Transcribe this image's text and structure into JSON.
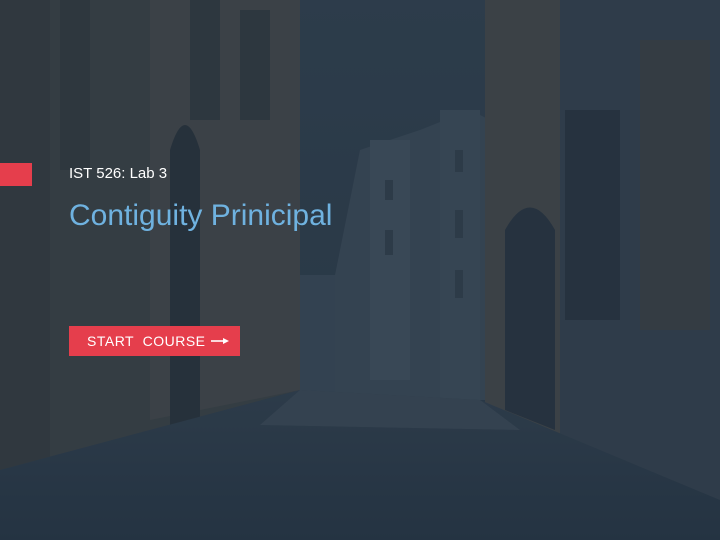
{
  "slide": {
    "subtitle": "IST 526: Lab 3",
    "title": "Contiguity Prinicipal",
    "start_button_label": "START  COURSE",
    "start_button_icon": "arrow-right-icon"
  },
  "colors": {
    "accent": "#e53e4c",
    "title": "#6fb2e0",
    "overlay": "#2c3a4b"
  },
  "background": {
    "icon": "cobblestone-street-photo"
  }
}
